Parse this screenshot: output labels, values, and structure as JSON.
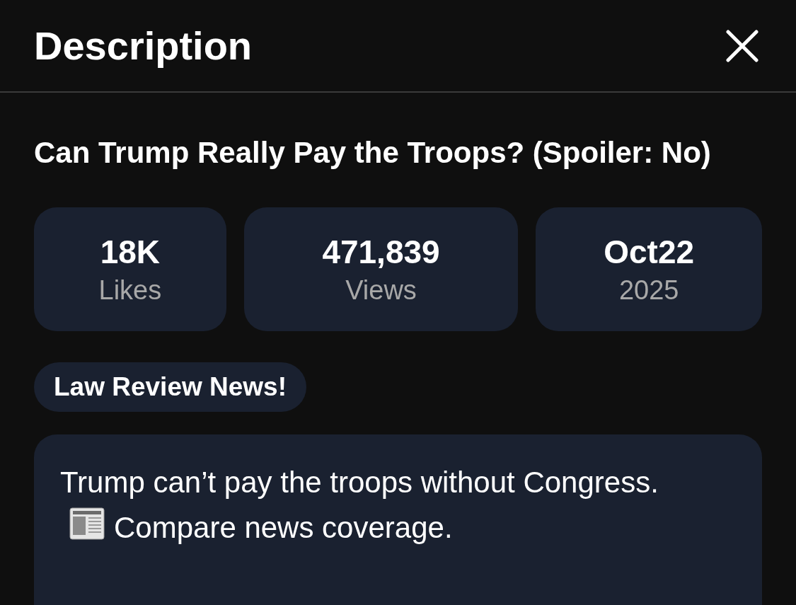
{
  "header": {
    "title": "Description"
  },
  "video": {
    "title": "Can Trump Really Pay the Troops? (Spoiler: No)"
  },
  "stats": [
    {
      "value": "18K",
      "label": "Likes"
    },
    {
      "value": "471,839",
      "label": "Views"
    },
    {
      "value": "Oct22",
      "label": "2025"
    }
  ],
  "chip": {
    "label": "Law Review News!"
  },
  "description": {
    "text_before": "Trump can’t pay the troops without Congress.",
    "text_after": "Compare news coverage."
  }
}
